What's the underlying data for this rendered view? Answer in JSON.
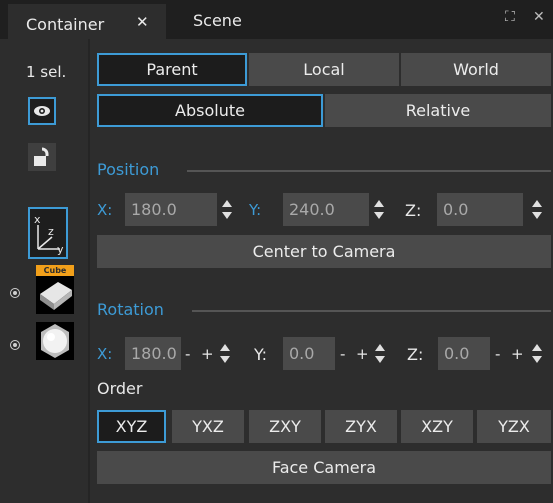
{
  "tabs": [
    {
      "label": "Container",
      "close": "✕"
    },
    {
      "label": "Scene"
    }
  ],
  "left": {
    "selection_count": "1 sel.",
    "cube_tag": "Cube"
  },
  "reference": {
    "parent": "Parent",
    "local": "Local",
    "world": "World",
    "absolute": "Absolute",
    "relative": "Relative"
  },
  "position": {
    "label": "Position",
    "x_label": "X:",
    "x_value": "180.0",
    "y_label": "Y:",
    "y_value": "240.0",
    "z_label": "Z:",
    "z_value": "0.0",
    "center_button": "Center to Camera"
  },
  "rotation": {
    "label": "Rotation",
    "x_label": "X:",
    "x_value": "180.0",
    "y_label": "Y:",
    "y_value": "0.0",
    "z_label": "Z:",
    "z_value": "0.0",
    "minus": "-",
    "plus": "+"
  },
  "order": {
    "label": "Order",
    "options": [
      "XYZ",
      "YXZ",
      "ZXY",
      "ZYX",
      "XZY",
      "YZX"
    ],
    "face_camera": "Face Camera"
  },
  "colors": {
    "accent": "#3d9bd6",
    "cube_tag": "#f2a01a"
  }
}
